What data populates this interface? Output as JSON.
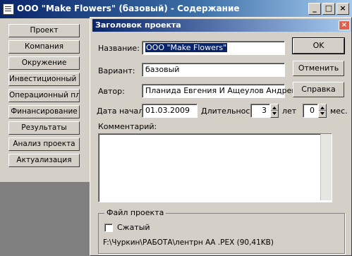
{
  "outer_window": {
    "title": "ООО \"Make Flowers\" (базовый) - Содержание",
    "controls": {
      "minimize": "_",
      "maximize": "□",
      "close": "×"
    }
  },
  "nav": {
    "items": [
      {
        "label": "Проект"
      },
      {
        "label": "Компания"
      },
      {
        "label": "Окружение"
      },
      {
        "label": "Инвестиционный план"
      },
      {
        "label": "Операционный план"
      },
      {
        "label": "Финансирование"
      },
      {
        "label": "Результаты"
      },
      {
        "label": "Анализ проекта"
      },
      {
        "label": "Актуализация"
      }
    ]
  },
  "dialog": {
    "title": "Заголовок проекта",
    "close_glyph": "×",
    "name_label": "Название:",
    "name_value": "ООО \"Make Flowers\"",
    "variant_label": "Вариант:",
    "variant_value": "базовый",
    "author_label": "Автор:",
    "author_value": "Планида Евгения И Ащеулов Андрей",
    "start_label": "Дата начала:",
    "start_value": "01.03.2009",
    "duration_label": "Длительность:",
    "duration_value": "3",
    "years_label": "лет",
    "months_value": "0",
    "months_label": "мес.",
    "comment_label": "Комментарий:",
    "comment_value": "",
    "buttons": {
      "ok": "OK",
      "cancel": "Отменить",
      "help": "Справка"
    },
    "file_group": {
      "title": "Файл проекта",
      "compressed_label": "Сжатый",
      "compressed_checked": false,
      "path": "F:\\Чуркин\\РАБОТА\\лентрн АА .PEX (90,41KB)"
    }
  },
  "colors": {
    "titlebar_active": "#0a246a",
    "face": "#d4d0c8",
    "workspace": "#808080"
  }
}
